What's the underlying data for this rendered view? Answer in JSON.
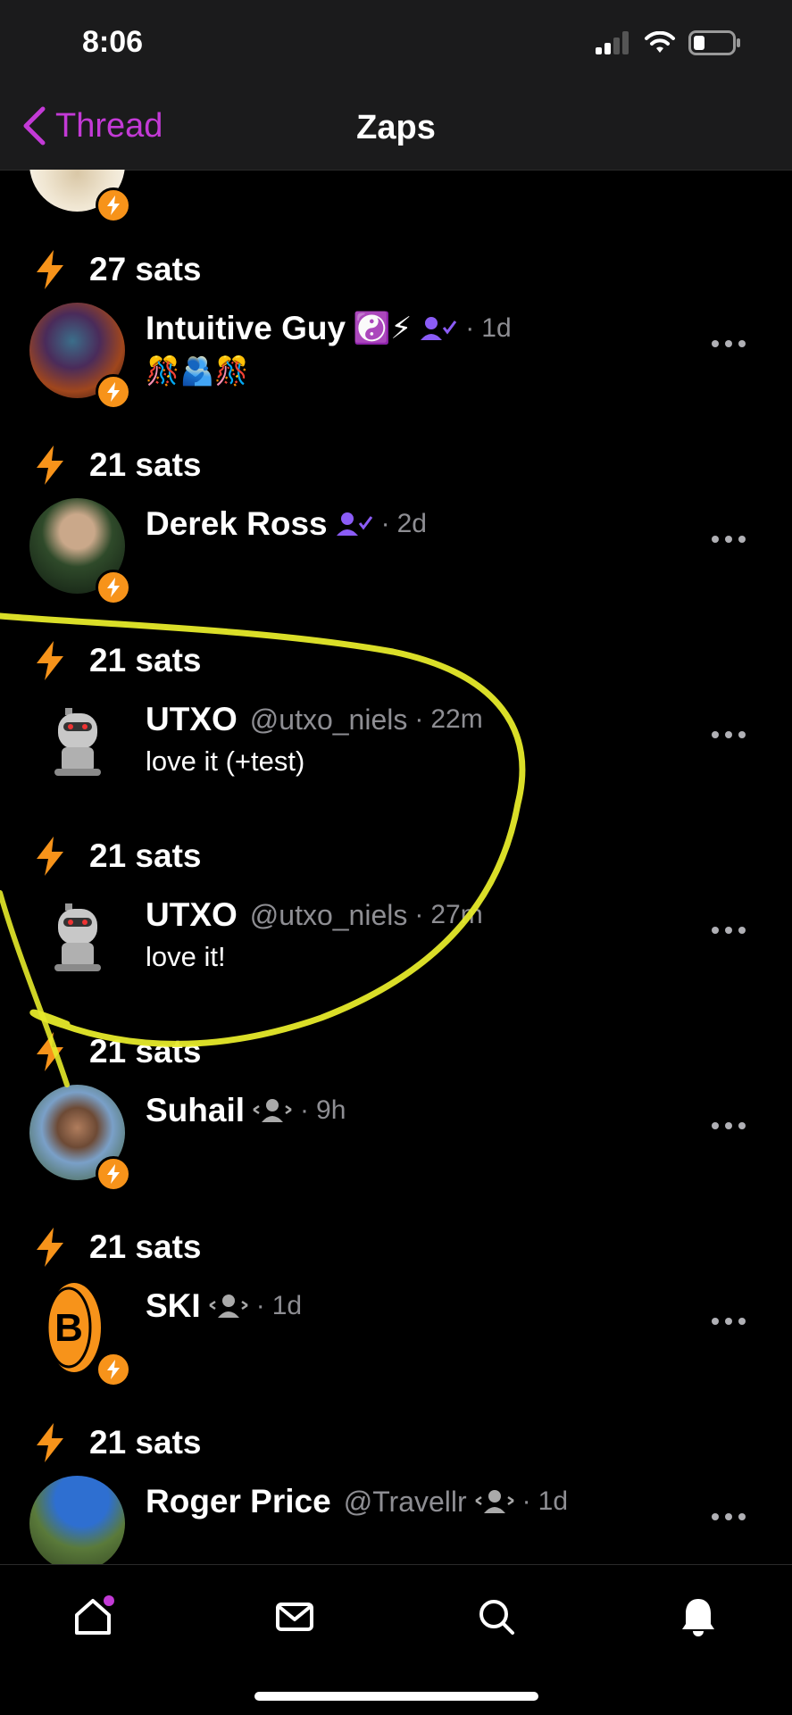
{
  "status": {
    "time": "8:06"
  },
  "nav": {
    "back_label": "Thread",
    "title": "Zaps"
  },
  "colors": {
    "accent": "#c33ad6",
    "zap": "#f7931a",
    "muted": "#8e8e93",
    "scribble": "#e6ea2a"
  },
  "zaps": [
    {
      "amount": "27 sats",
      "name": "Intuitive Guy",
      "name_emoji": "☯️⚡",
      "handle": "",
      "time": "1d",
      "note": "🎊🫂🎊",
      "badge": "verified-icon"
    },
    {
      "amount": "21 sats",
      "name": "Derek Ross",
      "name_emoji": "",
      "handle": "",
      "time": "2d",
      "note": "",
      "badge": "verified-icon"
    },
    {
      "amount": "21 sats",
      "name": "UTXO",
      "name_emoji": "",
      "handle": "@utxo_niels",
      "time": "22m",
      "note": "love it (+test)",
      "badge": ""
    },
    {
      "amount": "21 sats",
      "name": "UTXO",
      "name_emoji": "",
      "handle": "@utxo_niels",
      "time": "27m",
      "note": "love it!",
      "badge": ""
    },
    {
      "amount": "21 sats",
      "name": "Suhail",
      "name_emoji": "",
      "handle": "",
      "time": "9h",
      "note": "",
      "badge": "follows-icon"
    },
    {
      "amount": "21 sats",
      "name": "SKI",
      "name_emoji": "",
      "handle": "",
      "time": "1d",
      "note": "",
      "badge": "follows-icon"
    },
    {
      "amount": "21 sats",
      "name": "Roger Price",
      "name_emoji": "",
      "handle": "@Travellr",
      "time": "1d",
      "note": "",
      "badge": "follows-icon"
    }
  ],
  "tabs": [
    "home-icon",
    "messages-icon",
    "search-icon",
    "notifications-icon"
  ]
}
